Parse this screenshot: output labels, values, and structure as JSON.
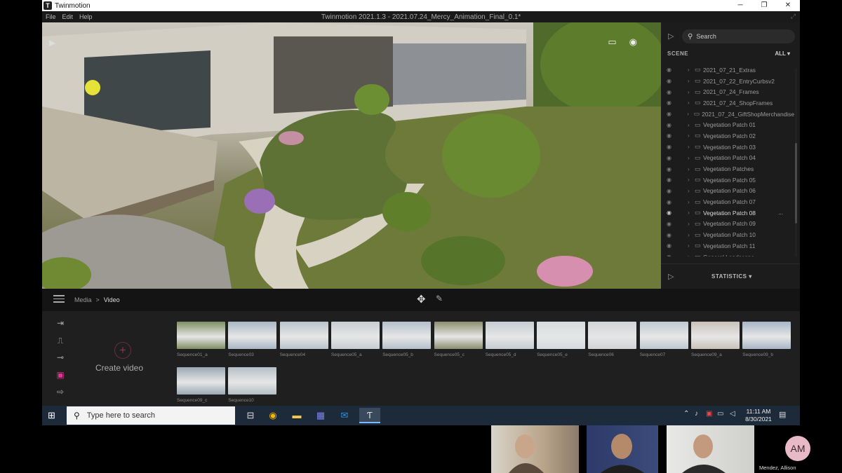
{
  "window": {
    "app_name": "Twinmotion",
    "document_title": "Twinmotion 2021.1.3 - 2021.07.24_Mercy_Animation_Final_0.1*",
    "logo_letter": "T",
    "minimize": "─",
    "maximize": "❐",
    "close": "✕"
  },
  "menu": {
    "file": "File",
    "edit": "Edit",
    "help": "Help"
  },
  "scene_panel": {
    "search_placeholder": "Search",
    "section_label": "SCENE",
    "filter_label": "ALL ▾",
    "items": [
      {
        "label": "2021_07_21_Extras"
      },
      {
        "label": "2021_07_22_EntryCurbsv2"
      },
      {
        "label": "2021_07_24_Frames"
      },
      {
        "label": "2021_07_24_ShopFrames"
      },
      {
        "label": "2021_07_24_GiftShopMerchandise"
      },
      {
        "label": "Vegetation Patch 01"
      },
      {
        "label": "Vegetation Patch 02"
      },
      {
        "label": "Vegetation Patch 03"
      },
      {
        "label": "Vegetation Patch 04"
      },
      {
        "label": "Vegetation Patches"
      },
      {
        "label": "Vegetation Patch 05"
      },
      {
        "label": "Vegetation Patch 06"
      },
      {
        "label": "Vegetation Patch 07"
      },
      {
        "label": "Vegetation Patch 08"
      },
      {
        "label": "Vegetation Patch 09"
      },
      {
        "label": "Vegetation Patch 10"
      },
      {
        "label": "Vegetation Patch 11"
      },
      {
        "label": "General Landscape"
      }
    ],
    "active_item": "Vegetation Patch 08",
    "more_label": "...",
    "statistics_label": "STATISTICS ▾"
  },
  "toolbar": {
    "breadcrumb_root": "Media",
    "breadcrumb_sep": ">",
    "breadcrumb_current": "Video"
  },
  "media": {
    "create_label": "Create video",
    "create_plus": "+",
    "thumbnails": [
      {
        "label": "Sequence01_a",
        "color": "#7f8f62"
      },
      {
        "label": "Sequence03",
        "color": "#a9b7c4"
      },
      {
        "label": "Sequence04",
        "color": "#b9c3cc"
      },
      {
        "label": "Sequence05_a",
        "color": "#c7cdd3"
      },
      {
        "label": "Sequence05_b",
        "color": "#b4c0cb"
      },
      {
        "label": "Sequence05_c",
        "color": "#8c8f6e"
      },
      {
        "label": "Sequence05_d",
        "color": "#c5ccd2"
      },
      {
        "label": "Sequence05_e",
        "color": "#d7dbde"
      },
      {
        "label": "Sequence06",
        "color": "#d1d4d6"
      },
      {
        "label": "Sequence07",
        "color": "#bfc9d1"
      },
      {
        "label": "Sequence09_a",
        "color": "#c8c2b9"
      },
      {
        "label": "Sequence09_b",
        "color": "#a7b6c6"
      },
      {
        "label": "Sequence09_c",
        "color": "#9aa8b3"
      },
      {
        "label": "Sequence10",
        "color": "#b5bfc6"
      }
    ]
  },
  "taskbar": {
    "search_placeholder": "Type here to search",
    "time": "11:11 AM",
    "date": "8/30/2021"
  },
  "video_call": {
    "participant_initials": "AM",
    "participant_name": "Mendez, Allison"
  },
  "colors": {
    "accent_pink": "#e0338f",
    "taskbar": "#1d2a3a"
  }
}
